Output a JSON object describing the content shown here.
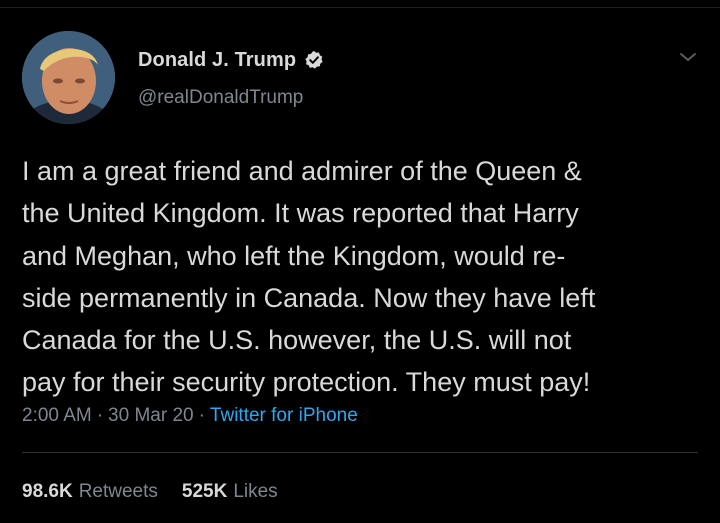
{
  "tweet": {
    "author": {
      "display_name": "Donald J. Trump",
      "handle": "@realDonaldTrump",
      "verified": true,
      "avatar_icon": "profile-photo"
    },
    "text_lines": [
      "I am a great friend and admirer of the Queen &",
      "the United Kingdom. It was reported that Harry",
      "and Meghan, who left the Kingdom, would re-",
      "side permanently in Canada. Now they have left",
      "Canada for the U.S. however, the U.S. will not",
      "pay for their security protection. They must pay!"
    ],
    "time": "2:00 AM",
    "date": "30 Mar 20",
    "separator": "·",
    "source": "Twitter for iPhone",
    "stats": {
      "retweets_count": "98.6K",
      "retweets_label": "Retweets",
      "likes_count": "525K",
      "likes_label": "Likes"
    },
    "menu_icon": "chevron-down-icon"
  },
  "colors": {
    "background": "#000000",
    "primary_text": "#d9d9d9",
    "secondary_text": "#7e8790",
    "link": "#2ea7f0",
    "divider": "#2b3035"
  }
}
